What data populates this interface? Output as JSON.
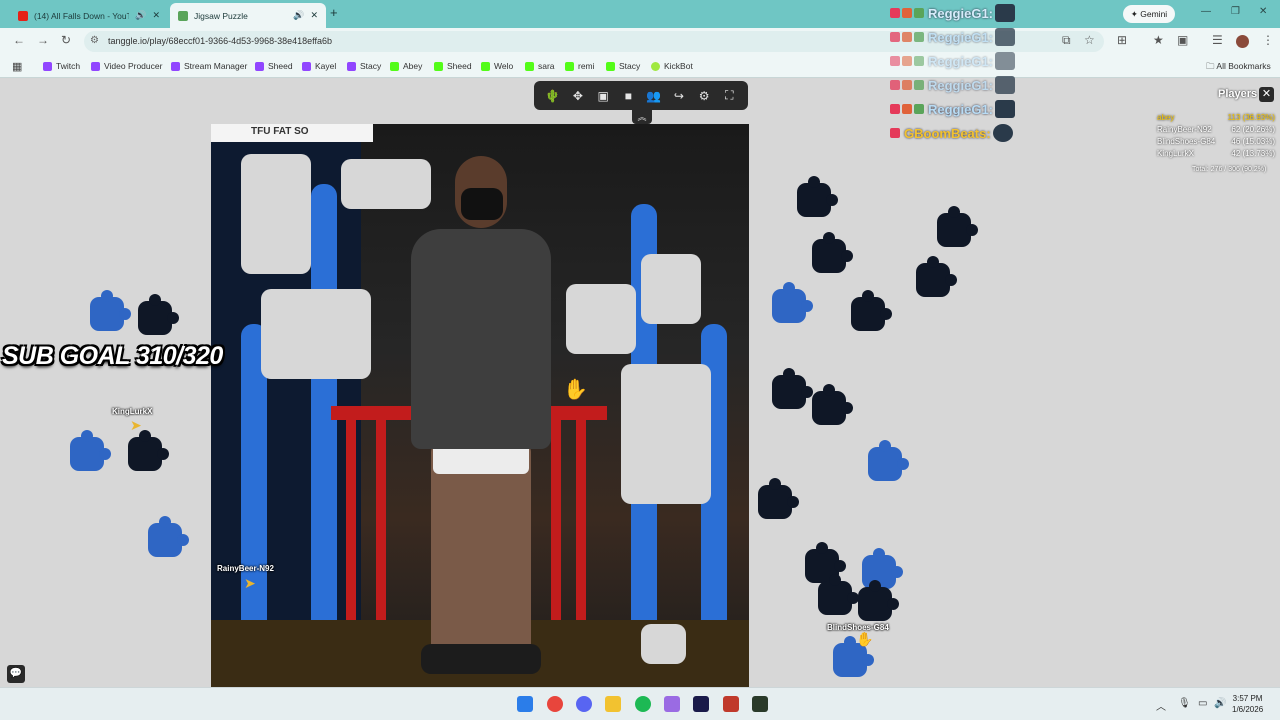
{
  "browser": {
    "tabs": [
      {
        "title": "(14) All Falls Down - YouTub",
        "favicon": "youtube-icon",
        "audio": "speaker-icon",
        "close": "✕"
      },
      {
        "title": "Jigsaw Puzzle",
        "favicon": "puzzle-icon",
        "audio": "speaker-icon",
        "close": "✕"
      }
    ],
    "new_tab": "+",
    "gemini_label": "Gemini",
    "url": "tanggle.io/play/68eccf01-9366-4d53-9968-38e418effa6b",
    "bookmarks": [
      {
        "label": "Twitch",
        "color": "#9146ff"
      },
      {
        "label": "Video Producer",
        "color": "#9146ff"
      },
      {
        "label": "Stream Manager",
        "color": "#9146ff"
      },
      {
        "label": "Sheed",
        "color": "#9146ff"
      },
      {
        "label": "Kayel",
        "color": "#9146ff"
      },
      {
        "label": "Stacy",
        "color": "#9146ff"
      },
      {
        "label": "Abey",
        "color": "#53fc18"
      },
      {
        "label": "Sheed",
        "color": "#53fc18"
      },
      {
        "label": "Welo",
        "color": "#53fc18"
      },
      {
        "label": "sara",
        "color": "#53fc18"
      },
      {
        "label": "remi",
        "color": "#53fc18"
      },
      {
        "label": "Stacy",
        "color": "#53fc18"
      },
      {
        "label": "KickBot",
        "color": "#a0e840"
      }
    ],
    "all_bookmarks": "All Bookmarks"
  },
  "game": {
    "board_banner": "TFU FAT SO",
    "sub_goal": "SUB GOAL 310/320",
    "cursors": [
      {
        "name": "KingLurkX"
      },
      {
        "name": "RainyBeer-N92"
      },
      {
        "name": "BlindShoes-G84"
      }
    ],
    "players_title": "Players",
    "players": [
      {
        "name": "abey",
        "score": "113 (36.93%)"
      },
      {
        "name": "RainyBeer-N92",
        "score": "62 (20.26%)"
      },
      {
        "name": "BlindShoes-G84",
        "score": "46 (15.03%)"
      },
      {
        "name": "KingLurkX",
        "score": "42 (13.73%)"
      }
    ],
    "total": "Total: 276 / 306 (90.2%)"
  },
  "chat": [
    {
      "name": "ReggieG1:"
    },
    {
      "name": "ReggieG1:"
    },
    {
      "name": "ReggieG1:"
    },
    {
      "name": "ReggieG1:"
    },
    {
      "name": "ReggieG1:"
    },
    {
      "name": "GBoomBeats:"
    }
  ],
  "taskbar": {
    "time": "3:57 PM",
    "date": "1/6/2026"
  },
  "colors": {
    "tab_strip": "#6fc6c4",
    "accent_gold": "#f3c400",
    "piece_blue": "#2f66c4"
  }
}
